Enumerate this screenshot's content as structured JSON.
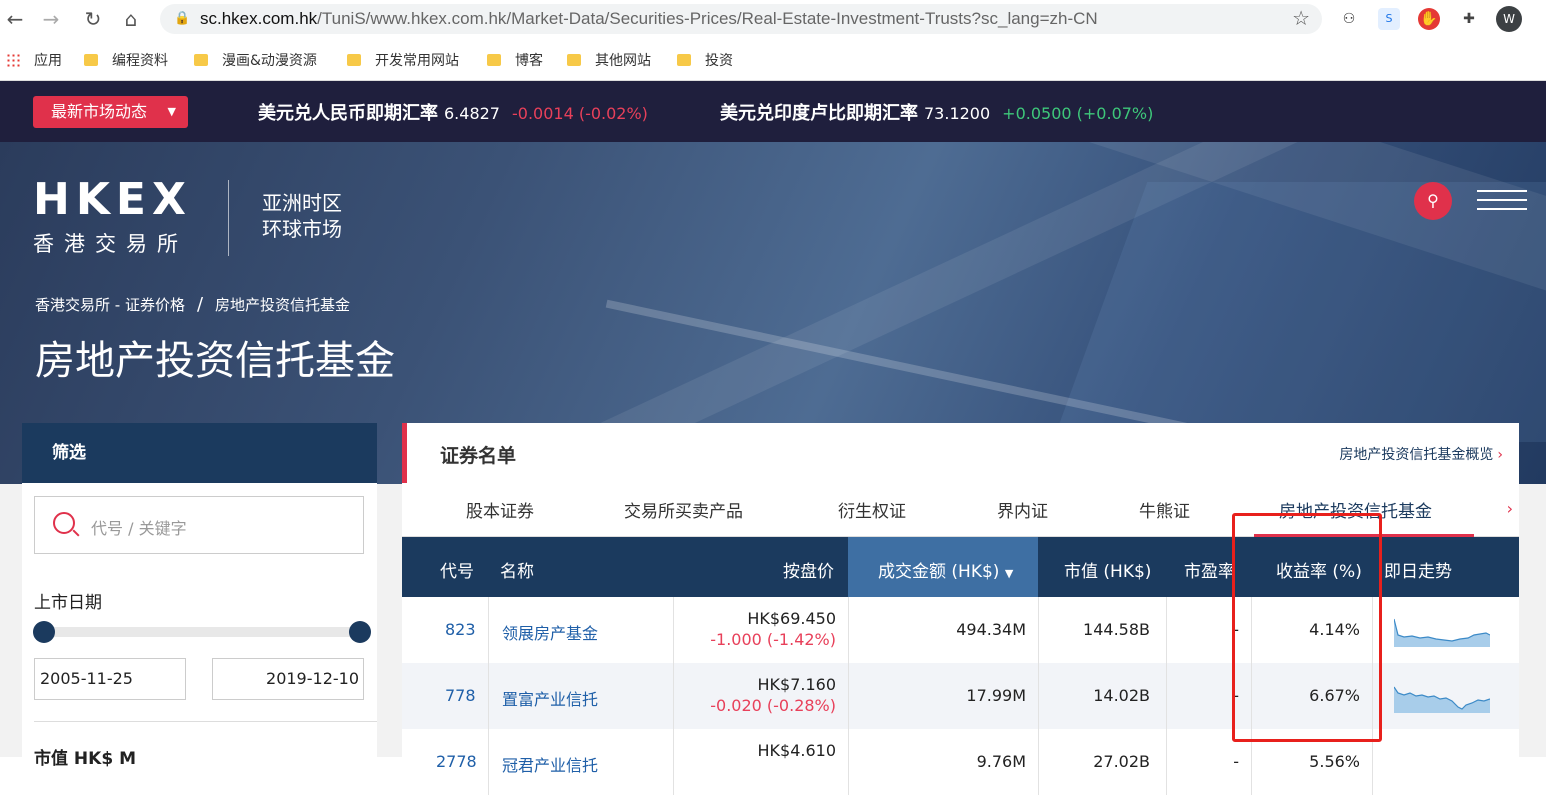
{
  "browser": {
    "url_host": "sc.hkex.com.hk",
    "url_path": "/TuniS/www.hkex.com.hk/Market-Data/Securities-Prices/Real-Estate-Investment-Trusts?sc_lang=zh-CN",
    "profile_initial": "W",
    "bookmarks": [
      "应用",
      "编程资料",
      "漫画&动漫资源",
      "开发常用网站",
      "博客",
      "其他网站",
      "投资"
    ]
  },
  "ticker": {
    "news_button": "最新市场动态",
    "items": [
      {
        "label": "美元兑人民币即期汇率",
        "value": "6.4827",
        "change": "-0.0014 (-0.02%)",
        "direction": "down"
      },
      {
        "label": "美元兑印度卢比即期汇率",
        "value": "73.1200",
        "change": "+0.0500 (+0.07%)",
        "direction": "up"
      }
    ]
  },
  "header": {
    "logo_text": "HKEX",
    "logo_cn": "香港交易所",
    "tagline_1": "亚洲时区",
    "tagline_2": "环球市场",
    "breadcrumb": [
      "香港交易所 - 证券价格",
      "房地产投资信托基金"
    ],
    "breadcrumb_sep": "/",
    "title": "房地产投资信托基金"
  },
  "sidebar": {
    "title": "筛选",
    "search_placeholder": "代号 / 关键字",
    "listing_date_label": "上市日期",
    "date_from": "2005-11-25",
    "date_to": "2019-12-10",
    "market_cap_label": "市值 HK$ M"
  },
  "panel": {
    "title": "证券名单",
    "overview_link": "房地产投资信托基金概览",
    "tabs": [
      "股本证券",
      "交易所买卖产品",
      "衍生权证",
      "界内证",
      "牛熊证",
      "房地产投资信托基金"
    ],
    "active_tab": 5,
    "columns": {
      "code": "代号",
      "name": "名称",
      "price": "按盘价",
      "turnover": "成交金额 (HK$)",
      "market_cap": "市值 (HK$)",
      "pe": "市盈率",
      "yield": "收益率 (%)",
      "intraday": "即日走势"
    },
    "rows": [
      {
        "code": "823",
        "name": "领展房产基金",
        "price": "HK$69.450",
        "change": "-1.000 (-1.42%)",
        "turnover": "494.34M",
        "market_cap": "144.58B",
        "pe": "-",
        "yield": "4.14%"
      },
      {
        "code": "778",
        "name": "置富产业信托",
        "price": "HK$7.160",
        "change": "-0.020 (-0.28%)",
        "turnover": "17.99M",
        "market_cap": "14.02B",
        "pe": "-",
        "yield": "6.67%"
      },
      {
        "code": "2778",
        "name": "冠君产业信托",
        "price": "HK$4.610",
        "change": "",
        "turnover": "9.76M",
        "market_cap": "27.02B",
        "pe": "-",
        "yield": "5.56%"
      }
    ]
  },
  "colors": {
    "navy": "#1b3a5e",
    "accent_red": "#e0314b",
    "ticker_bg": "#1f1f3d",
    "sorted_col": "#3e6fa3",
    "highlight_box": "#e8201c"
  }
}
